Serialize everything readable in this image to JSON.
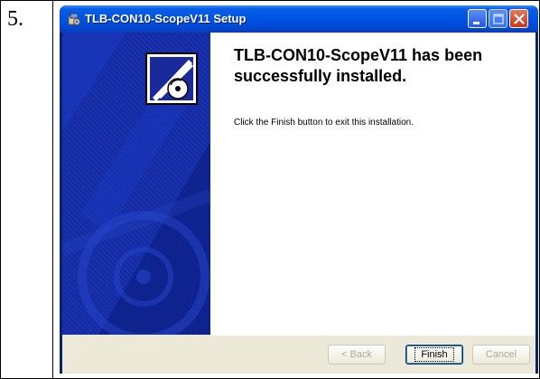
{
  "step": {
    "number": "5."
  },
  "window": {
    "title": "TLB-CON10-ScopeV11 Setup"
  },
  "wizard": {
    "heading": "TLB-CON10-ScopeV11 has been successfully installed.",
    "message": "Click the Finish button to exit this installation."
  },
  "buttons": {
    "back": "< Back",
    "finish": "Finish",
    "cancel": "Cancel"
  },
  "colors": {
    "titlebar": "#0054e3",
    "banner": "#122aa6",
    "close_button": "#c8361c"
  }
}
